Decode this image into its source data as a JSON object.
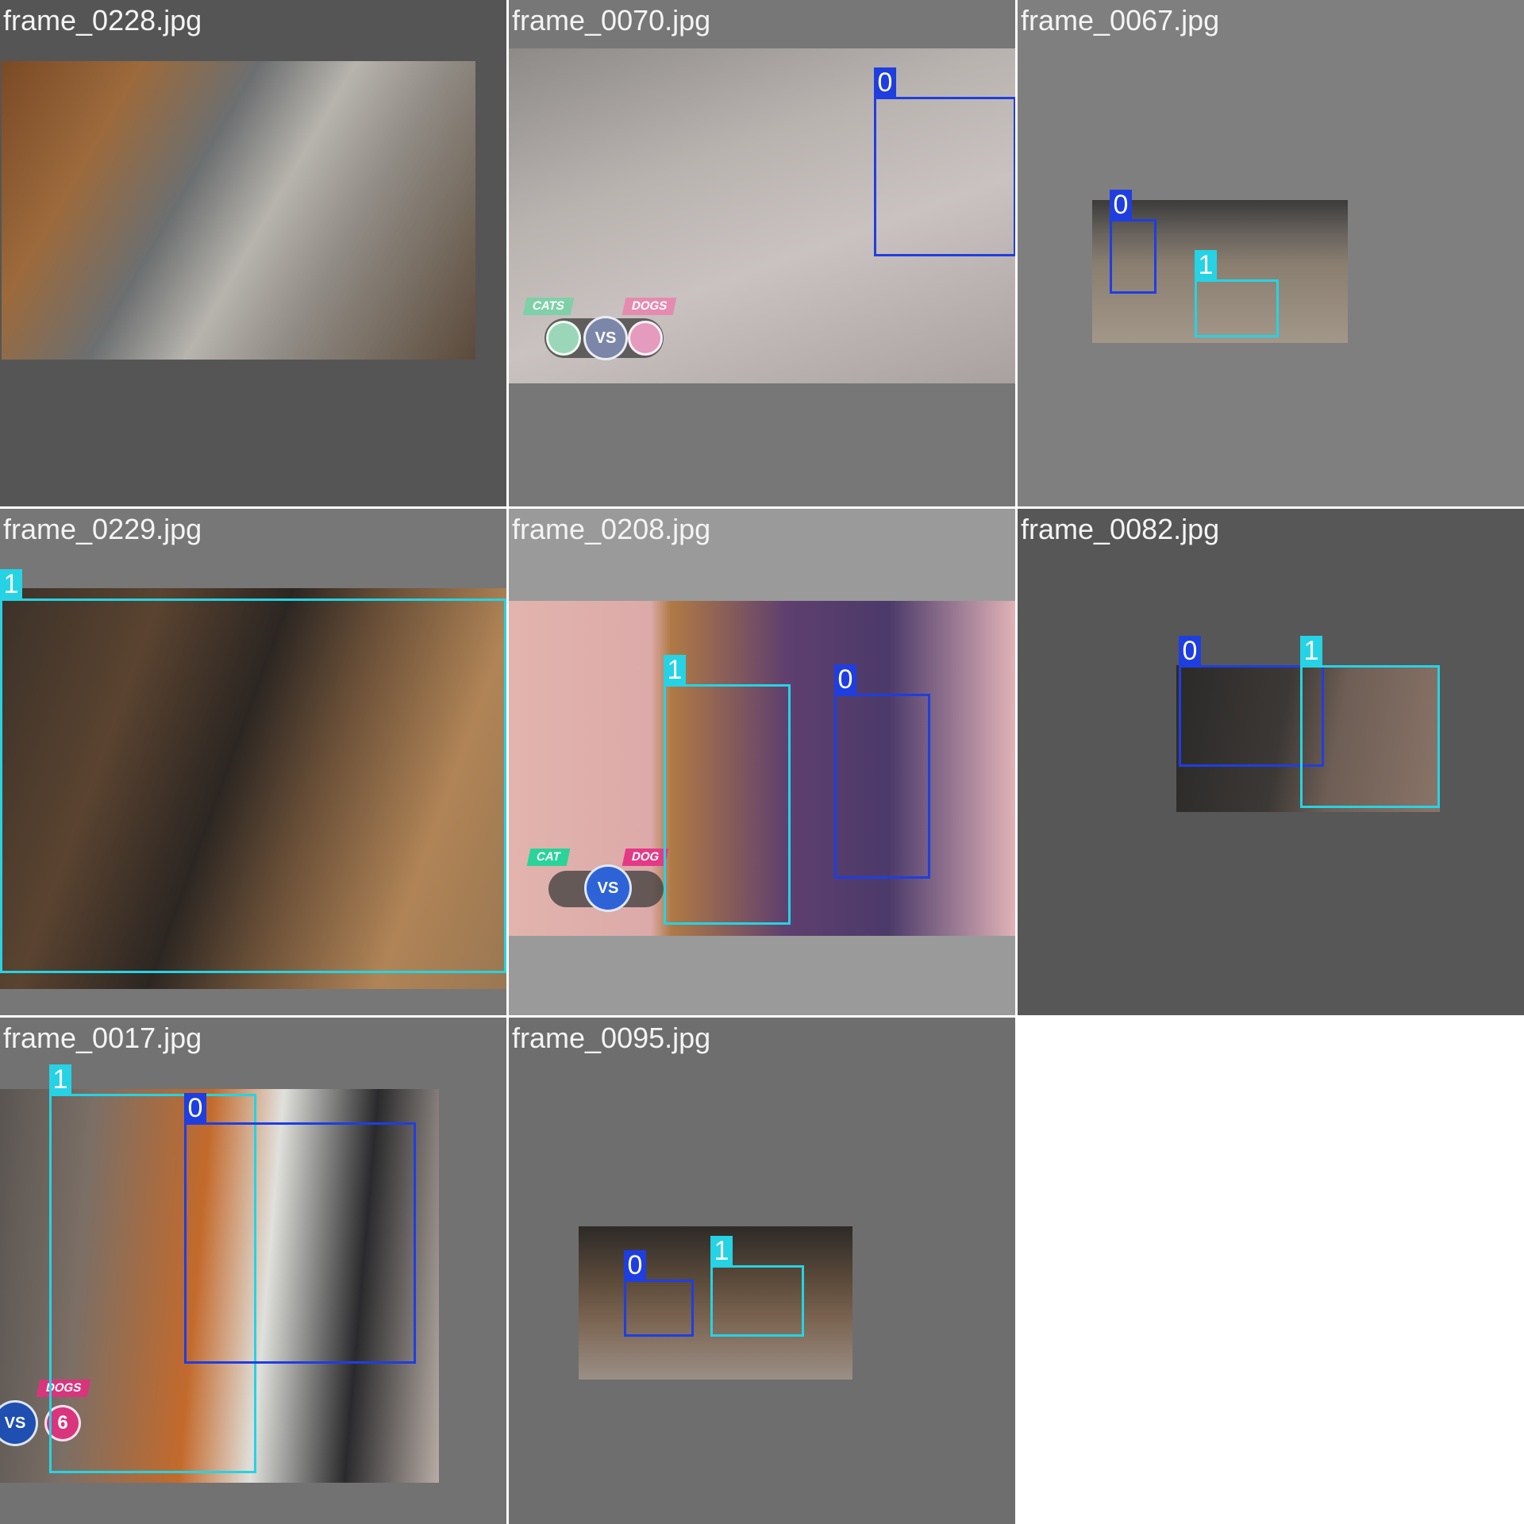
{
  "colors": {
    "class_0_box": "#1f3ee0",
    "class_1_box": "#25d3e4",
    "title_text": "#f4f4f4"
  },
  "tiles": [
    {
      "title": "frame_0228.jpg",
      "background": "#555555",
      "boxes": []
    },
    {
      "title": "frame_0070.jpg",
      "background": "#777777",
      "boxes": [
        {
          "label": "0"
        }
      ],
      "overlay": {
        "left_tag": "CATS",
        "right_tag": "DOGS",
        "center": "VS"
      }
    },
    {
      "title": "frame_0067.jpg",
      "background": "#7f7f7f",
      "boxes": [
        {
          "label": "0"
        },
        {
          "label": "1"
        }
      ]
    },
    {
      "title": "frame_0229.jpg",
      "background": "#777777",
      "boxes": [
        {
          "label": "1"
        }
      ]
    },
    {
      "title": "frame_0208.jpg",
      "background": "#9a9a9a",
      "boxes": [
        {
          "label": "1"
        },
        {
          "label": "0"
        }
      ],
      "overlay": {
        "left_tag": "CAT",
        "right_tag": "DOG",
        "center": "VS"
      }
    },
    {
      "title": "frame_0082.jpg",
      "background": "#575757",
      "boxes": [
        {
          "label": "0"
        },
        {
          "label": "1"
        }
      ]
    },
    {
      "title": "frame_0017.jpg",
      "background": "#727272",
      "boxes": [
        {
          "label": "1"
        },
        {
          "label": "0"
        }
      ],
      "overlay": {
        "right_tag": "DOGS",
        "center": "VS",
        "score": "6"
      }
    },
    {
      "title": "frame_0095.jpg",
      "background": "#6e6e6e",
      "boxes": [
        {
          "label": "0"
        },
        {
          "label": "1"
        }
      ]
    }
  ]
}
